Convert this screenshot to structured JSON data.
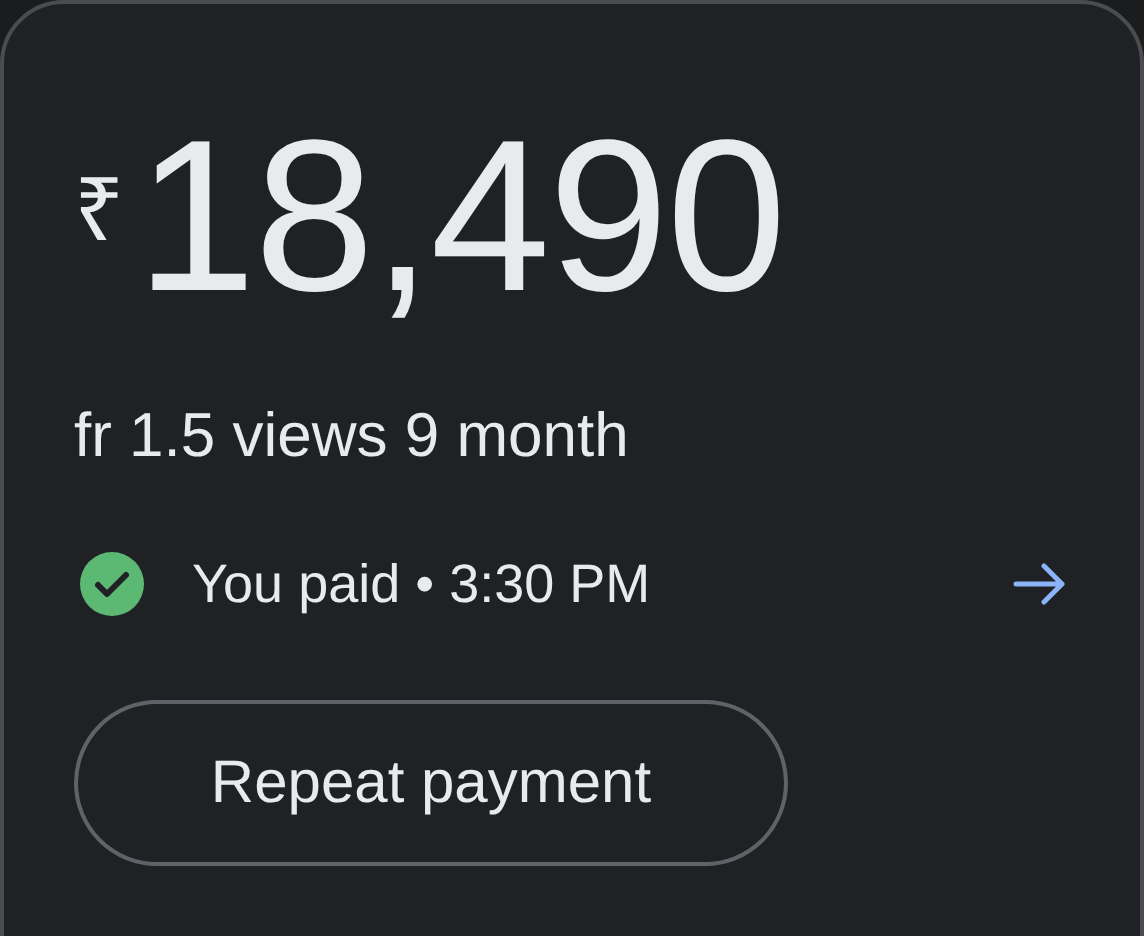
{
  "payment": {
    "currency": "₹",
    "amount": "18,490",
    "note": "fr 1.5 views 9 month",
    "status": "You paid",
    "separator": "•",
    "time": "3:30 PM",
    "paid": true
  },
  "buttons": [
    "Repeat payment"
  ]
}
